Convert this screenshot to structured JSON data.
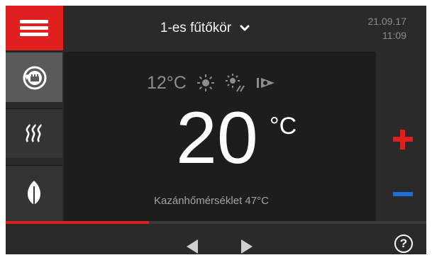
{
  "header": {
    "circuit_label": "1-es fűtőkör",
    "date": "21.09.17",
    "time": "11:09"
  },
  "sidebar": {
    "items": [
      {
        "name": "operating-mode",
        "icon": "auto-schedule-icon",
        "active": true
      },
      {
        "name": "heating",
        "icon": "heating-waves-icon",
        "active": false
      },
      {
        "name": "eco",
        "icon": "leaf-icon",
        "active": false
      }
    ]
  },
  "main": {
    "outdoor_temp": "12°C",
    "icons": [
      "sun-icon",
      "sun-partly-icon",
      "comfort-mode-icon"
    ],
    "setpoint_value": "20",
    "setpoint_unit": "°C",
    "boiler_label": "Kazánhőmérséklet 47°C"
  },
  "controls": {
    "plus_icon": "plus-icon",
    "minus_icon": "minus-icon"
  },
  "progress": {
    "fraction": 0.34
  },
  "colors": {
    "accent": "#e0201f",
    "minus": "#1d6fd6",
    "background": "#2a2a2a"
  }
}
